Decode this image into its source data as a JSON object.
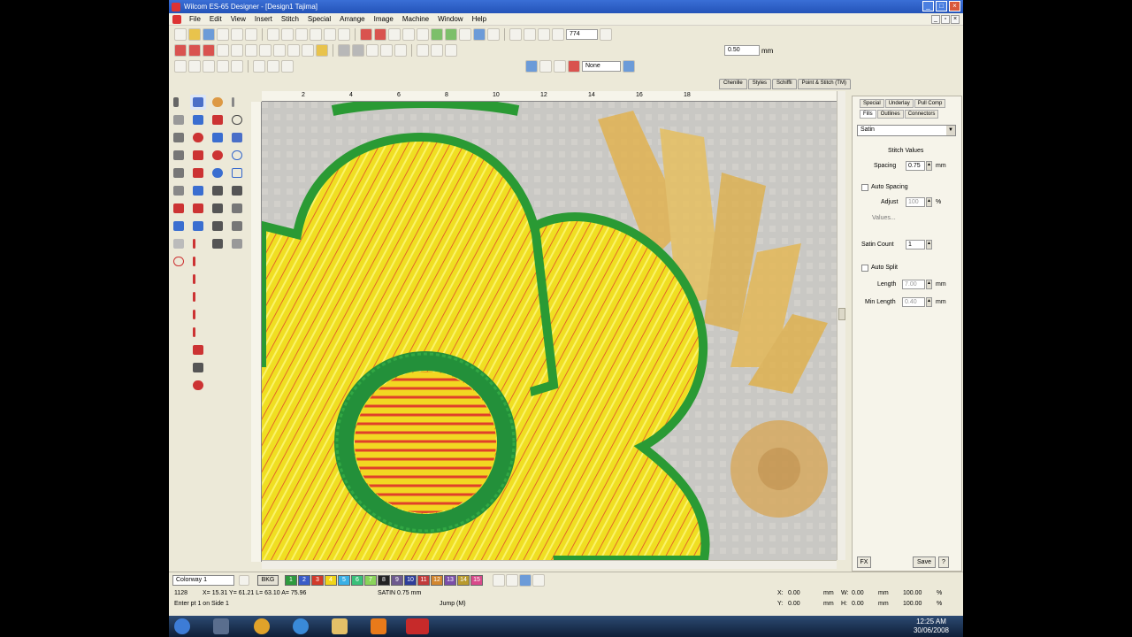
{
  "window": {
    "title": "Wilcom ES-65 Designer - [Design1      Tajima]"
  },
  "menu": [
    "File",
    "Edit",
    "View",
    "Insert",
    "Stitch",
    "Special",
    "Arrange",
    "Image",
    "Machine",
    "Window",
    "Help"
  ],
  "toolbar": {
    "zoom_value": "774",
    "none_label": "None",
    "spacing_field": "0.50",
    "mm_unit": "mm"
  },
  "ruler_ticks": [
    "2",
    "4",
    "6",
    "8",
    "10",
    "12",
    "14",
    "16",
    "18"
  ],
  "top_tabs": [
    "Chenille",
    "Styles",
    "Schiffli",
    "Point & Stitch (TM)"
  ],
  "props": {
    "tabs_row1": [
      "Special",
      "Underlay",
      "Pull Comp"
    ],
    "tabs_row2": [
      "Fills",
      "Outlines",
      "Connectors"
    ],
    "stitch_type": "Satin",
    "section_title": "Stitch Values",
    "spacing_label": "Spacing",
    "spacing_value": "0.75",
    "unit_mm": "mm",
    "auto_spacing": "Auto Spacing",
    "adjust_label": "Adjust",
    "adjust_value": "100",
    "percent": "%",
    "values_label": "Values...",
    "satin_count_label": "Satin Count",
    "satin_count_value": "1",
    "auto_split": "Auto Split",
    "length_label": "Length",
    "length_value": "7.00",
    "min_length_label": "Min Length",
    "min_length_value": "0.40",
    "fx_label": "FX",
    "save_label": "Save",
    "help_label": "?"
  },
  "colorbar": {
    "colorway": "Colorway 1",
    "bkg_label": "BKG",
    "swatches": [
      {
        "label": "1",
        "color": "#2e9a3e"
      },
      {
        "label": "2",
        "color": "#3a5cc8"
      },
      {
        "label": "3",
        "color": "#d23a2a"
      },
      {
        "label": "4",
        "color": "#f1d51a"
      },
      {
        "label": "5",
        "color": "#3ab0e6"
      },
      {
        "label": "6",
        "color": "#3ac07a"
      },
      {
        "label": "7",
        "color": "#8ad45a"
      },
      {
        "label": "8",
        "color": "#222222"
      },
      {
        "label": "9",
        "color": "#6e5a8e"
      },
      {
        "label": "10",
        "color": "#2e3e9a"
      },
      {
        "label": "11",
        "color": "#c23a3a"
      },
      {
        "label": "12",
        "color": "#d2862e"
      },
      {
        "label": "13",
        "color": "#7a4ea8"
      },
      {
        "label": "14",
        "color": "#b89a2e"
      },
      {
        "label": "15",
        "color": "#d84a8a"
      }
    ]
  },
  "status": {
    "stitch_count": "1128",
    "coords": "X= 15.31  Y= 61.21  L= 63.10  A= 75.96",
    "satin": "SATIN  0.75 mm",
    "hint": "Enter pt 1 on Side 1",
    "jump": "Jump (M)",
    "x_label": "X:",
    "x_value": "0.00",
    "y_label": "Y:",
    "y_value": "0.00",
    "w_label": "W:",
    "w_value": "0.00",
    "h_label": "H:",
    "h_value": "0.00",
    "pct_a": "100.00",
    "pct_b": "100.00",
    "mm": "mm",
    "pct": "%"
  },
  "clock": {
    "time": "12:25 AM",
    "date": "30/06/2008"
  }
}
